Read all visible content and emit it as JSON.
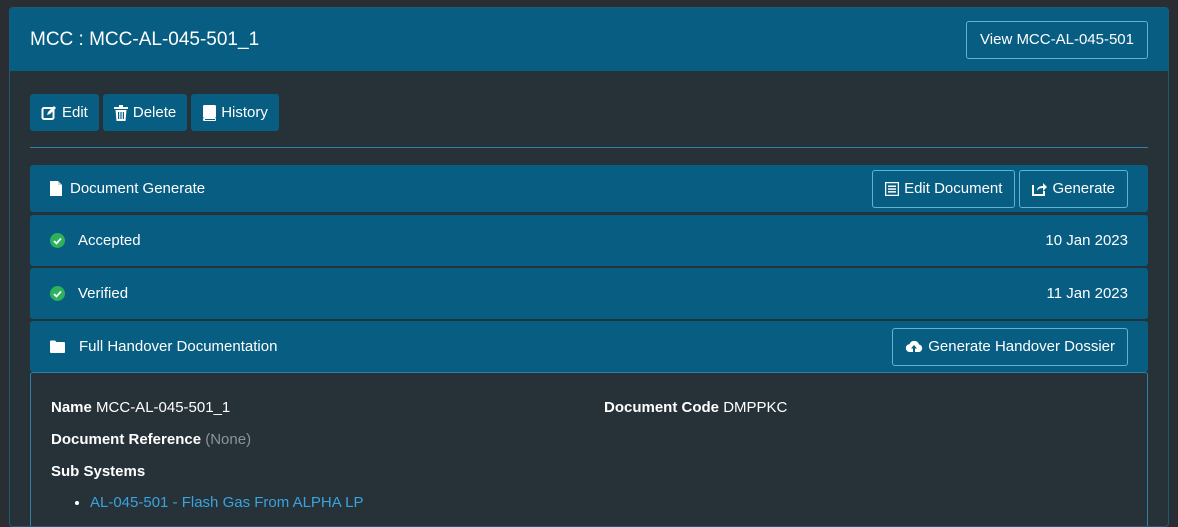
{
  "header": {
    "title": "MCC : MCC-AL-045-501_1",
    "view_button": "View MCC-AL-045-501"
  },
  "toolbar": {
    "edit": "Edit",
    "delete": "Delete",
    "history": "History"
  },
  "rows": {
    "document_generate": {
      "label": "Document Generate",
      "edit_document": "Edit Document",
      "generate": "Generate"
    },
    "accepted": {
      "label": "Accepted",
      "date": "10 Jan 2023"
    },
    "verified": {
      "label": "Verified",
      "date": "11 Jan 2023"
    },
    "handover": {
      "label": "Full Handover Documentation",
      "button": "Generate Handover Dossier"
    }
  },
  "details": {
    "name_label": "Name",
    "name_value": "MCC-AL-045-501_1",
    "code_label": "Document Code",
    "code_value": "DMPPKC",
    "reference_label": "Document Reference",
    "reference_value": "(None)",
    "subsystems_label": "Sub Systems",
    "subsystems": [
      "AL-045-501 - Flash Gas From ALPHA LP"
    ]
  },
  "colors": {
    "header": "#075d82",
    "panel": "#263238",
    "success": "#2db15a",
    "link": "#3aa3dd"
  }
}
